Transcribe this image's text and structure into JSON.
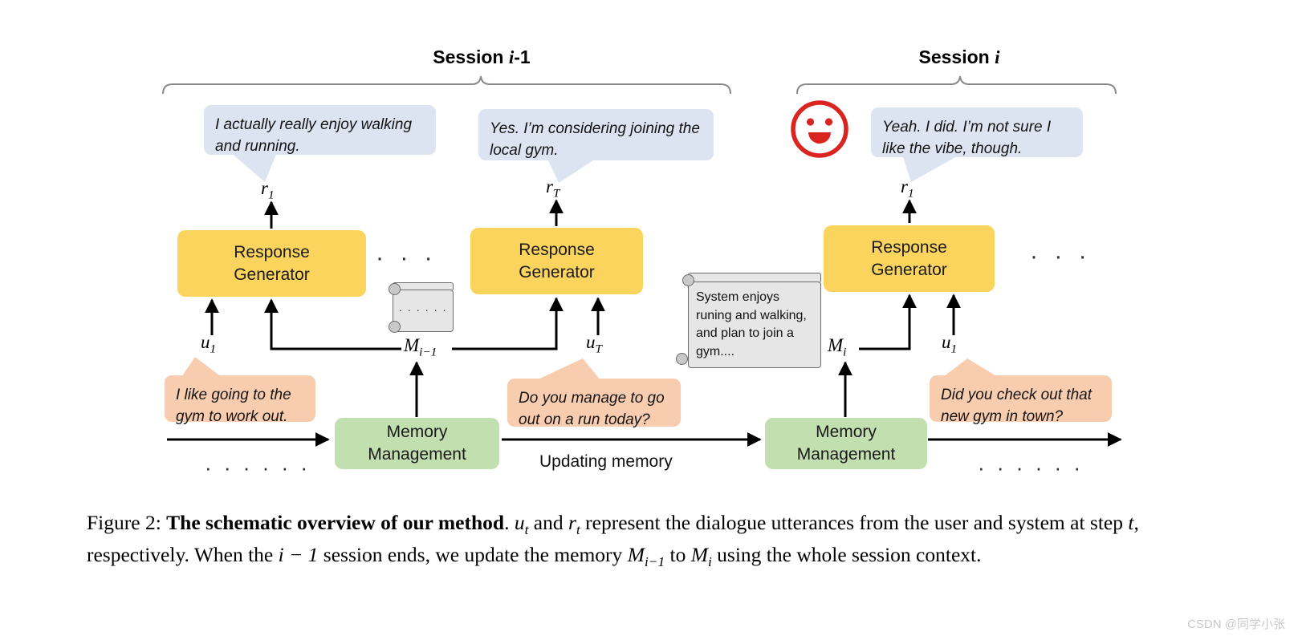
{
  "figure": {
    "sessions": [
      {
        "label_prefix": "Session ",
        "label_var": "i",
        "label_suffix": "-1"
      },
      {
        "label_prefix": "Session ",
        "label_var": "i",
        "label_suffix": ""
      }
    ],
    "system_bubbles": [
      {
        "text": "I actually really enjoy walking and running."
      },
      {
        "text": "Yes. I’m considering joining the local gym."
      },
      {
        "text": "Yeah. I did. I’m not sure I like the vibe, though."
      }
    ],
    "user_bubbles": [
      {
        "text": "I like going to the gym to work out."
      },
      {
        "text": "Do you manage to go out on a run today?"
      },
      {
        "text": "Did you check out that new gym in town?"
      }
    ],
    "response_generators": [
      {
        "line1": "Response",
        "line2": "Generator"
      },
      {
        "line1": "Response",
        "line2": "Generator"
      },
      {
        "line1": "Response",
        "line2": "Generator"
      }
    ],
    "memory_managers": [
      {
        "line1": "Memory",
        "line2": "Management"
      },
      {
        "line1": "Memory",
        "line2": "Management"
      }
    ],
    "response_labels": [
      {
        "base": "r",
        "sub": "1"
      },
      {
        "base": "r",
        "sub": "T"
      },
      {
        "base": "r",
        "sub": "1"
      }
    ],
    "utterance_labels": [
      {
        "base": "u",
        "sub": "1"
      },
      {
        "base": "u",
        "sub": "T"
      },
      {
        "base": "u",
        "sub": "1"
      }
    ],
    "memory_labels": [
      {
        "base": "M",
        "sub": "i−1"
      },
      {
        "base": "M",
        "sub": "i"
      }
    ],
    "memory_note_small": {
      "text": "· · · · · ·"
    },
    "memory_note_large": {
      "text": "System enjoys runing and walking, and plan to join a gym...."
    },
    "updating_memory_label": "Updating memory",
    "timeline_dots_left": "· · · · · ·",
    "timeline_dots_right": "· · · · · ·",
    "ellipsis_mid": "· · ·",
    "ellipsis_right": "· · ·",
    "emoji_icon_name": "smiley-face-icon",
    "colors": {
      "response_generator": "#FBD45E",
      "memory_management": "#C2DFB0",
      "system_bubble": "#DCE4F2",
      "user_bubble": "#F8CDAF",
      "emoji": "#D9241F",
      "note": "#E6E6E6",
      "arrow": "#000000",
      "bracket": "#808080"
    }
  },
  "caption": {
    "figure_number": "Figure 2:",
    "bold_title": "The schematic overview of our method",
    "rest_1": ". ",
    "m1": "u",
    "m1_sub": "t",
    "rest_2": " and ",
    "m2": "r",
    "m2_sub": "t",
    "rest_3": " represent the dialogue utterances from the user and system at step ",
    "m3": "t",
    "rest_4": ", respectively. When the ",
    "m4": "i − 1",
    "rest_5": " session ends, we update the memory ",
    "m5": "M",
    "m5_sub": "i−1",
    "rest_6": " to ",
    "m6": "M",
    "m6_sub": "i",
    "rest_7": " using the whole session context."
  },
  "watermark": {
    "text": "CSDN @同学小张"
  }
}
